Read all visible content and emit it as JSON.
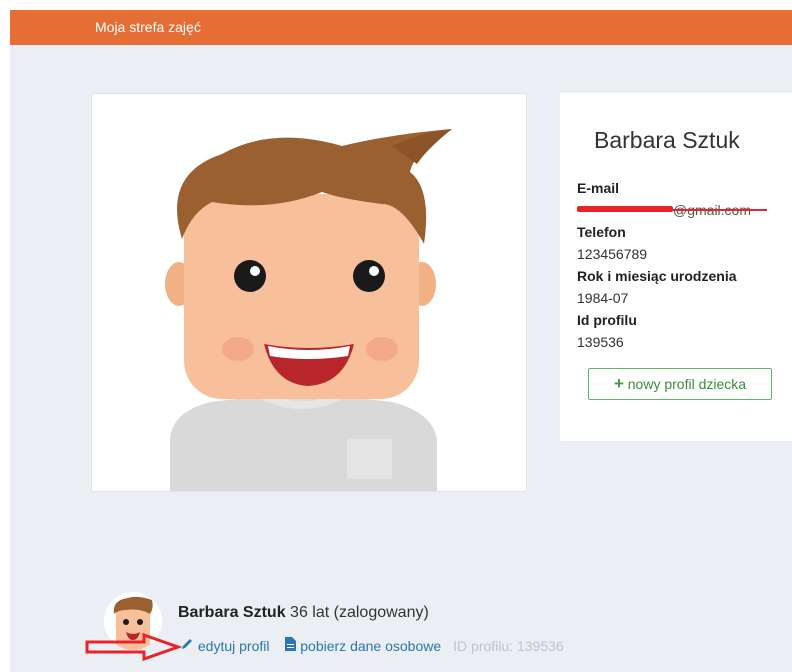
{
  "header": {
    "title": "Moja strefa zajęć"
  },
  "profile": {
    "name": "Barbara Sztuk",
    "fields": [
      {
        "label": "E-mail",
        "value": "@gmail.com",
        "redacted": true
      },
      {
        "label": "Telefon",
        "value": "123456789"
      },
      {
        "label": "Rok i miesiąc urodzenia",
        "value": "1984-07"
      },
      {
        "label": "Id profilu",
        "value": "139536"
      }
    ],
    "new_child_button": "nowy profil dziecka"
  },
  "summary": {
    "name": "Barbara Sztuk",
    "age_text": "36 lat (zalogowany)",
    "edit_link": "edytuj profil",
    "download_link": "pobierz dane osobowe",
    "profile_id_text": "ID profilu: 139536"
  },
  "colors": {
    "header": "#e56e35",
    "background": "#ebeef2",
    "link": "#2a77b3",
    "success": "#5cb85c",
    "annotation_arrow": "#e8242a"
  }
}
